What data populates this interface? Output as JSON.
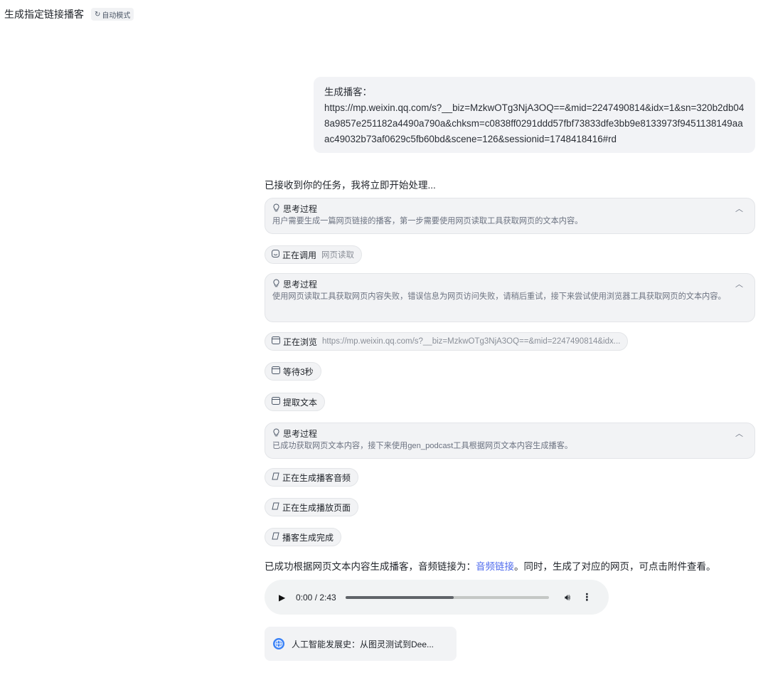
{
  "header": {
    "title": "生成指定链接播客",
    "mode_badge": "自动模式",
    "mode_icon": "sync-icon"
  },
  "user_message": {
    "label": "生成播客：",
    "url": "https://mp.weixin.qq.com/s?__biz=MzkwOTg3NjA3OQ==&mid=2247490814&idx=1&sn=320b2db048a9857e251182a4490a790a&chksm=c0838ff0291ddd57fbf73833dfe3bb9e8133973f9451138149aaac49032b73af0629c5fb60bd&scene=126&sessionid=1748418416#rd"
  },
  "reply_intro": "已接收到你的任务，我将立即开始处理...",
  "thinking": [
    {
      "title": "思考过程",
      "body": "用户需要生成一篇网页链接的播客，第一步需要使用网页读取工具获取网页的文本内容。"
    },
    {
      "title": "思考过程",
      "body": "使用网页读取工具获取网页内容失败，错误信息为网页访问失败，请稍后重试，接下来尝试使用浏览器工具获取网页的文本内容。"
    },
    {
      "title": "思考过程",
      "body": "已成功获取网页文本内容，接下来使用gen_podcast工具根据网页文本内容生成播客。"
    }
  ],
  "steps": [
    {
      "label": "正在调用",
      "detail": "网页读取",
      "icon": "tool-icon"
    },
    {
      "label": "正在浏览",
      "detail": "https://mp.weixin.qq.com/s?__biz=MzkwOTg3NjA3OQ==&mid=2247490814&idx...",
      "icon": "browser-icon"
    },
    {
      "label": "等待3秒",
      "detail": "",
      "icon": "browser-icon"
    },
    {
      "label": "提取文本",
      "detail": "",
      "icon": "browser-icon"
    },
    {
      "label": "正在生成播客音频",
      "detail": "",
      "icon": "podcast-icon"
    },
    {
      "label": "正在生成播放页面",
      "detail": "",
      "icon": "podcast-icon"
    },
    {
      "label": "播客生成完成",
      "detail": "",
      "icon": "podcast-icon"
    }
  ],
  "result": {
    "before": "已成功根据网页文本内容生成播客，音频链接为：",
    "link": "音频链接",
    "after": "。同时，生成了对应的网页，可点击附件查看。"
  },
  "audio": {
    "current": "0:00",
    "duration": "2:43",
    "time_text": "0:00 / 2:43",
    "buffered": 0.53
  },
  "attachment": {
    "name": "人工智能发展史：从图灵测试到Dee...",
    "icon": "globe-icon"
  },
  "colors": {
    "link": "#4f6bed",
    "bubble": "#f2f3f6",
    "card": "#f2f3f5"
  }
}
